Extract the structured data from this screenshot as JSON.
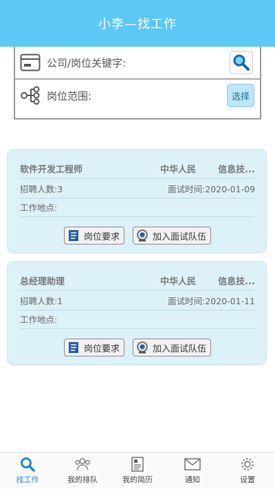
{
  "header": {
    "title": "小李—找工作"
  },
  "search": {
    "keyword_label": "公司/岗位关键字:",
    "scope_label": "岗位范围:",
    "select_button": "选择"
  },
  "jobs": [
    {
      "title": "软件开发工程师",
      "company": "中华人民",
      "industry": "信息技...",
      "count_label": "招聘人数:3",
      "interview_label": "面试时间:2020-01-09",
      "location_label": "工作地点:",
      "requirements_button": "岗位要求",
      "join_button": "加入面试队伍"
    },
    {
      "title": "总经理助理",
      "company": "中华人民",
      "industry": "信息技...",
      "count_label": "招聘人数:1",
      "interview_label": "面试时间:2020-01-11",
      "location_label": "工作地点:",
      "requirements_button": "岗位要求",
      "join_button": "加入面试队伍"
    }
  ],
  "tabs": [
    {
      "label": "找工作",
      "icon": "search-icon",
      "active": true
    },
    {
      "label": "我的排队",
      "icon": "people-icon"
    },
    {
      "label": "我的简历",
      "icon": "resume-icon"
    },
    {
      "label": "通知",
      "icon": "envelope-icon"
    },
    {
      "label": "设置",
      "icon": "gear-icon"
    }
  ],
  "colors": {
    "header": "#5cc8f5",
    "card": "#ddf1f9",
    "active_tab": "#1e88c8"
  }
}
